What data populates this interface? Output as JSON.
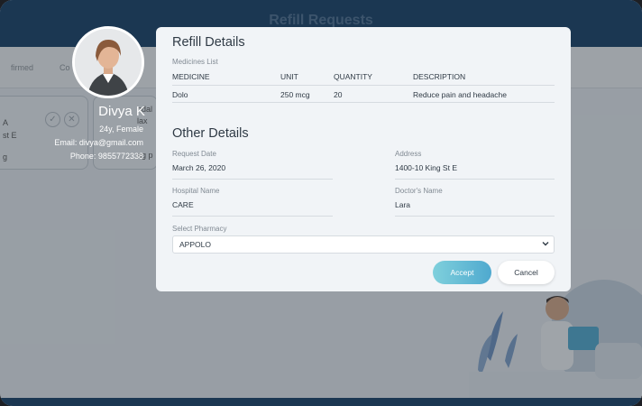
{
  "header": {
    "title": "Refill Requests"
  },
  "background": {
    "tabs": [
      "firmed",
      "Co"
    ],
    "card_lines": [
      "A",
      "st E",
      "g"
    ],
    "second_card_lines": [
      "ndal",
      "lax",
      "ng p"
    ]
  },
  "profile": {
    "name": "Divya K",
    "age_gender": "24y, Female",
    "email": "Email: divya@gmail.com",
    "phone": "Phone: 9855772338"
  },
  "modal": {
    "title": "Refill Details",
    "medicines_label": "Medicines List",
    "columns": [
      "MEDICINE",
      "UNIT",
      "QUANTITY",
      "DESCRIPTION"
    ],
    "rows": [
      {
        "medicine": "Dolo",
        "unit": "250 mcg",
        "quantity": "20",
        "description": "Reduce pain and headache"
      }
    ],
    "other_title": "Other Details",
    "request_date_label": "Request Date",
    "request_date": "March 26, 2020",
    "address_label": "Address",
    "address": "1400-10 King St E",
    "hospital_label": "Hospital Name",
    "hospital": "CARE",
    "doctor_label": "Doctor's Name",
    "doctor": "Lara",
    "pharmacy_label": "Select Pharmacy",
    "pharmacy_value": "APPOLO",
    "accept_label": "Accept",
    "cancel_label": "Cancel"
  },
  "colors": {
    "header": "#123b63",
    "accept_gradient_start": "#7fd0dc",
    "accept_gradient_end": "#4fa9cf"
  }
}
